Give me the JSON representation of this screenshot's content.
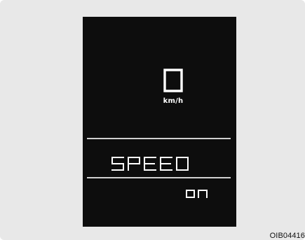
{
  "cluster": {
    "speed": {
      "value": "0",
      "unit": "km/h"
    },
    "menu": {
      "label": "SPEED",
      "value": "on"
    }
  },
  "figure": {
    "code": "OIB04416"
  },
  "colors": {
    "display_bg": "#0d0d0d",
    "segment": "#ffffff",
    "divider": "#d0d0d0",
    "panel_bg": "#e8e8e8"
  }
}
